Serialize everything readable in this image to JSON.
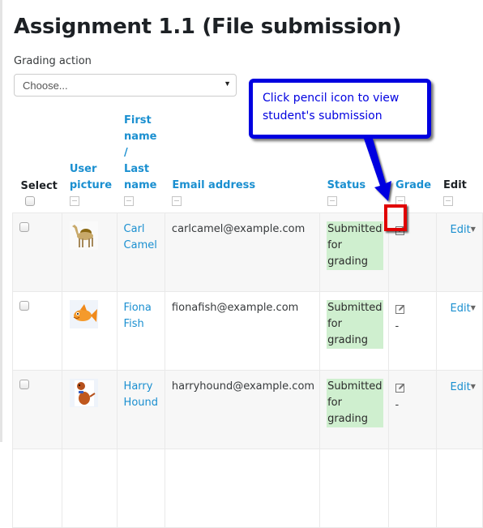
{
  "page": {
    "title": "Assignment 1.1 (File submission)"
  },
  "grading_action": {
    "label": "Grading action",
    "selected": "Choose..."
  },
  "table": {
    "headers": {
      "select": "Select",
      "user_picture_1": "User",
      "user_picture_2": "picture",
      "name_1": "First",
      "name_2": "name /",
      "name_3": "Last",
      "name_4": "name",
      "email": "Email address",
      "status": "Status",
      "grade": "Grade",
      "edit": "Edit"
    },
    "rows": [
      {
        "first": "Carl",
        "last": "Camel",
        "email": "carlcamel@example.com",
        "status_1": "Submitted",
        "status_2": "for",
        "status_3": "grading",
        "grade": "",
        "edit": "Edit",
        "picture": "camel-avatar"
      },
      {
        "first": "Fiona",
        "last": "Fish",
        "email": "fionafish@example.com",
        "status_1": "Submitted",
        "status_2": "for",
        "status_3": "grading",
        "grade": "-",
        "edit": "Edit",
        "picture": "fish-avatar"
      },
      {
        "first": "Harry",
        "last": "Hound",
        "email": "harryhound@example.com",
        "status_1": "Submitted",
        "status_2": "for",
        "status_3": "grading",
        "grade": "-",
        "edit": "Edit",
        "picture": "dog-avatar"
      }
    ]
  },
  "annotation": {
    "text_1": "Click pencil icon to view",
    "text_2": "student's submission",
    "color": "#0000e0",
    "highlight_color": "#e00000"
  },
  "colors": {
    "link": "#1a8fd0",
    "status_bg": "#cfefcf"
  }
}
